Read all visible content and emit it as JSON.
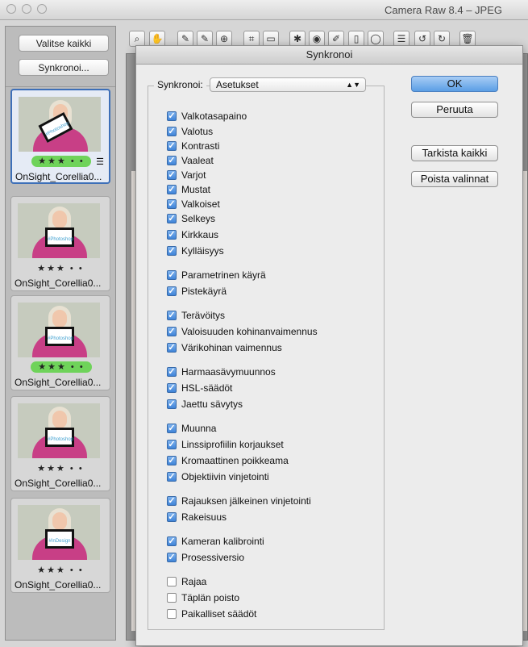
{
  "window": {
    "title": "Camera Raw 8.4  –  JPEG",
    "controls": [
      "close",
      "minimize",
      "zoom"
    ]
  },
  "filmstrip": {
    "select_all_label": "Valitse kaikki",
    "sync_label": "Synkronoi...",
    "thumbnails": [
      {
        "name": "OnSight_Corellia0...",
        "stars": "★★★ • •",
        "rating": 3,
        "label_green": true,
        "selected": true,
        "sign": "#Photoshop"
      },
      {
        "name": "OnSight_Corellia0...",
        "stars": "★★★ • •",
        "rating": 3,
        "label_green": false,
        "selected": false,
        "sign": "#Photoshop"
      },
      {
        "name": "OnSight_Corellia0...",
        "stars": "★★★ • •",
        "rating": 3,
        "label_green": true,
        "selected": false,
        "sign": "#Photoshop"
      },
      {
        "name": "OnSight_Corellia0...",
        "stars": "★★★ • •",
        "rating": 3,
        "label_green": false,
        "selected": false,
        "sign": "#Photoshop"
      },
      {
        "name": "OnSight_Corellia0...",
        "stars": "★★★ • •",
        "rating": 3,
        "label_green": false,
        "selected": false,
        "sign": "#InDesign"
      }
    ]
  },
  "toolbar": {
    "tools": [
      "zoom-icon",
      "hand-icon",
      "white-balance-icon",
      "color-sampler-icon",
      "target-adjust-icon",
      "crop-icon",
      "straighten-icon",
      "spot-removal-icon",
      "red-eye-icon",
      "adjustment-brush-icon",
      "graduated-filter-icon",
      "radial-filter-icon",
      "list-icon",
      "rotate-ccw-icon",
      "rotate-cw-icon",
      "trash-icon"
    ]
  },
  "dialog": {
    "title": "Synkronoi",
    "sync_label": "Synkronoi:",
    "sync_value": "Asetukset",
    "ok_label": "OK",
    "cancel_label": "Peruuta",
    "check_all_label": "Tarkista kaikki",
    "uncheck_all_label": "Poista valinnat",
    "items": [
      {
        "label": "Valkotasapaino",
        "checked": true
      },
      {
        "label": "Valotus",
        "checked": true
      },
      {
        "label": "Kontrasti",
        "checked": true
      },
      {
        "label": "Vaaleat",
        "checked": true
      },
      {
        "label": "Varjot",
        "checked": true
      },
      {
        "label": "Mustat",
        "checked": true
      },
      {
        "label": "Valkoiset",
        "checked": true
      },
      {
        "label": "Selkeys",
        "checked": true
      },
      {
        "label": "Kirkkaus",
        "checked": true
      },
      {
        "label": "Kylläisyys",
        "checked": true
      },
      {
        "label": "Parametrinen käyrä",
        "checked": true
      },
      {
        "label": "Pistekäyrä",
        "checked": true
      },
      {
        "label": "Terävöitys",
        "checked": true
      },
      {
        "label": "Valoisuuden kohinanvaimennus",
        "checked": true
      },
      {
        "label": "Värikohinan vaimennus",
        "checked": true
      },
      {
        "label": "Harmaasävymuunnos",
        "checked": true
      },
      {
        "label": "HSL-säädöt",
        "checked": true
      },
      {
        "label": "Jaettu sävytys",
        "checked": true
      },
      {
        "label": "Muunna",
        "checked": true
      },
      {
        "label": "Linssiprofiilin korjaukset",
        "checked": true
      },
      {
        "label": "Kromaattinen poikkeama",
        "checked": true
      },
      {
        "label": "Objektiivin vinjetointi",
        "checked": true
      },
      {
        "label": "Rajauksen jälkeinen vinjetointi",
        "checked": true
      },
      {
        "label": "Rakeisuus",
        "checked": true
      },
      {
        "label": "Kameran kalibrointi",
        "checked": true
      },
      {
        "label": "Prosessiversio",
        "checked": true
      },
      {
        "label": "Rajaa",
        "checked": false
      },
      {
        "label": "Täplän poisto",
        "checked": false
      },
      {
        "label": "Paikalliset säädöt",
        "checked": false
      }
    ]
  },
  "colors": {
    "accent_blue": "#5b9ee5",
    "label_green": "#6fd35a",
    "selection_border": "#3d6fb8"
  }
}
